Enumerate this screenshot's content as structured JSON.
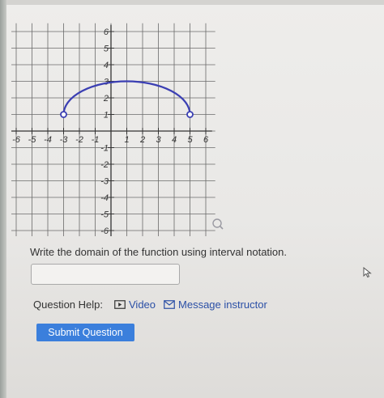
{
  "graph": {
    "x_tick_labels": [
      "-6",
      "-5",
      "-4",
      "-3",
      "-2",
      "-1",
      "1",
      "2",
      "3",
      "4",
      "5",
      "6"
    ],
    "y_tick_labels": [
      "6",
      "5",
      "4",
      "3",
      "2",
      "1",
      "-1",
      "-2",
      "-3",
      "-4",
      "-5",
      "-6"
    ],
    "x_range": [
      -6,
      6
    ],
    "y_range": [
      -6,
      6
    ],
    "curve": {
      "shape": "semicircle",
      "left_endpoint": [
        -3,
        1
      ],
      "right_endpoint": [
        5,
        1
      ],
      "peak_y": 3,
      "endpoints": "open",
      "color": "#3b3fb3"
    },
    "zoom_icon": "magnifier-icon"
  },
  "question": {
    "prompt": "Write the domain of the function using interval notation."
  },
  "answer": {
    "value": "",
    "placeholder": ""
  },
  "help": {
    "label": "Question Help:",
    "video_label": "Video",
    "video_icon": "video-icon",
    "message_label": "Message instructor",
    "message_icon": "mail-icon"
  },
  "submit": {
    "label": "Submit Question",
    "color": "#3b7fdc"
  }
}
